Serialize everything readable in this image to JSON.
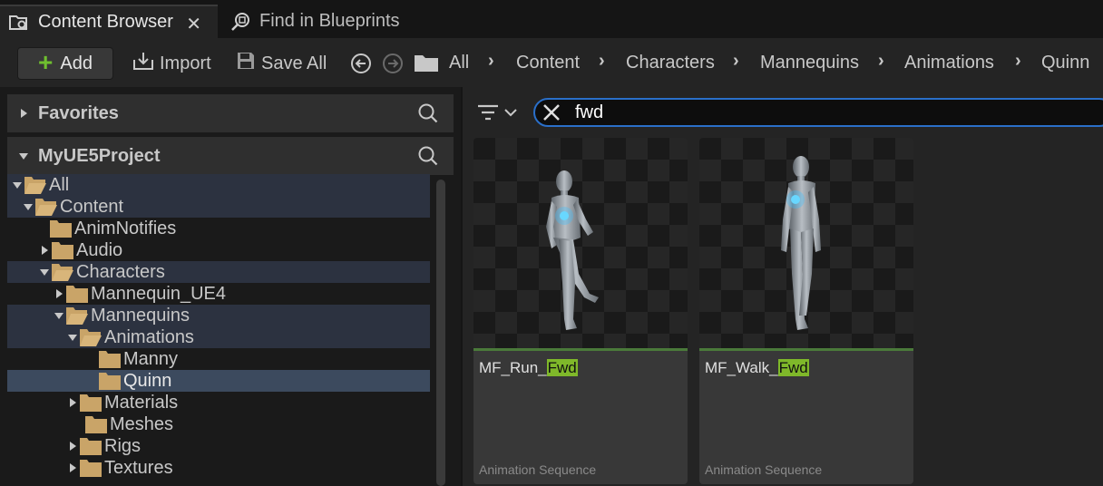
{
  "tabs": [
    {
      "label": "Content Browser",
      "icon": "content-browser-icon",
      "active": true
    },
    {
      "label": "Find in Blueprints",
      "icon": "find-in-blueprints-icon",
      "active": false
    }
  ],
  "toolbar": {
    "add_label": "Add",
    "import_label": "Import",
    "save_all_label": "Save All"
  },
  "breadcrumb": [
    "All",
    "Content",
    "Characters",
    "Mannequins",
    "Animations",
    "Quinn"
  ],
  "left_panel": {
    "favorites_label": "Favorites",
    "project_label": "MyUE5Project",
    "tree": [
      {
        "label": "All",
        "expanded": true
      },
      {
        "label": "Content",
        "expanded": true
      },
      {
        "label": "AnimNotifies"
      },
      {
        "label": "Audio",
        "collapsed": true
      },
      {
        "label": "Characters",
        "expanded": true
      },
      {
        "label": "Mannequin_UE4",
        "collapsed": true
      },
      {
        "label": "Mannequins",
        "expanded": true
      },
      {
        "label": "Animations",
        "expanded": true
      },
      {
        "label": "Manny"
      },
      {
        "label": "Quinn",
        "selected": true
      },
      {
        "label": "Materials",
        "collapsed": true
      },
      {
        "label": "Meshes"
      },
      {
        "label": "Rigs",
        "collapsed": true
      },
      {
        "label": "Textures",
        "collapsed": true
      }
    ]
  },
  "search": {
    "value": "fwd"
  },
  "assets": [
    {
      "name_prefix": "MF_Run_",
      "name_match": "Fwd",
      "type": "Animation Sequence"
    },
    {
      "name_prefix": "MF_Walk_",
      "name_match": "Fwd",
      "type": "Animation Sequence"
    }
  ],
  "colors": {
    "accent_blue": "#2a6fc9",
    "folder": "#c9a468",
    "highlight_green": "#7fb82a",
    "add_plus": "#6fbf2f"
  }
}
